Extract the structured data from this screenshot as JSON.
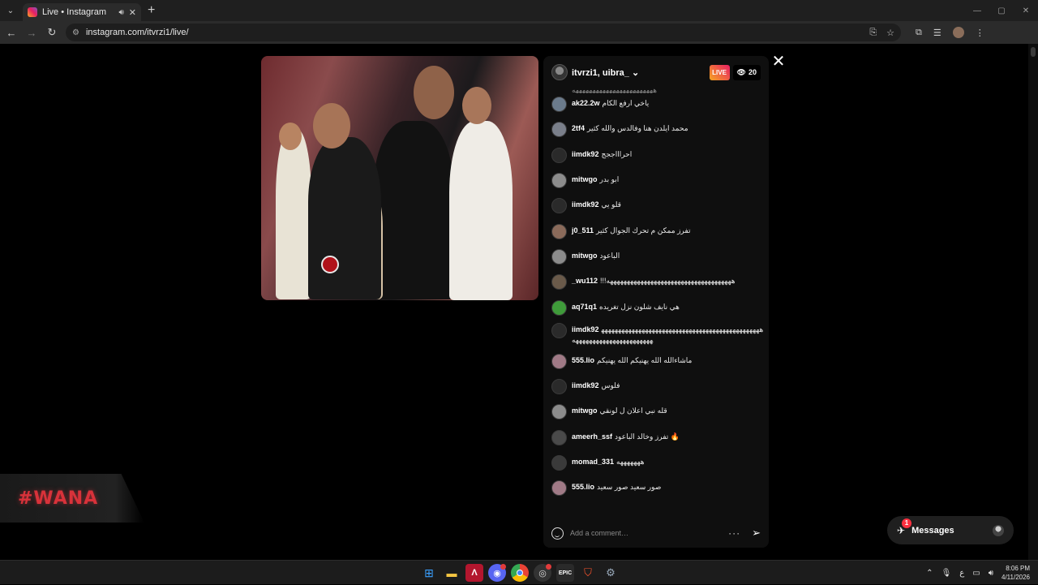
{
  "browser": {
    "tab_title": "Live • Instagram",
    "url": "instagram.com/itvrzi1/live/",
    "tab_list_icon": "chevron-down",
    "new_tab_icon": "+"
  },
  "live": {
    "host_names": "itvrzi1, uibra_",
    "live_label": "LIVE",
    "viewer_count": "20",
    "overlay_logo_text": "#WANA",
    "comment_placeholder": "Add a comment…",
    "truncated_line": "ههههههههههههههههههههههههه",
    "comments": [
      {
        "user": "ak22.2w",
        "text": "ياخي ارفع الكام",
        "avatar_color": "#6b7b8c"
      },
      {
        "user": "2tf4",
        "text": "محمد ايلدن هنا وفالدس والله كثير",
        "avatar_color": "#7a7f8a"
      },
      {
        "user": "iimdk92",
        "text": "احراااججج",
        "avatar_color": "#2a2a2a"
      },
      {
        "user": "mitwgo",
        "text": "ابو بدر",
        "avatar_color": "#8c8c8c"
      },
      {
        "user": "iimdk92",
        "text": "قلو يي",
        "avatar_color": "#2a2a2a"
      },
      {
        "user": "j0_511",
        "text": "تفرز ممكن م تحرك الجوال كثير",
        "avatar_color": "#8a6a5a"
      },
      {
        "user": "mitwgo",
        "text": "الباعود",
        "avatar_color": "#8c8c8c"
      },
      {
        "user": "_wu112",
        "text": "!!!هههههههههههههههههههههههههههههههههههههه",
        "avatar_color": "#6a5a4a"
      },
      {
        "user": "aq71q1",
        "text": "هي نايف شلون نزل تغريده",
        "avatar_color": "#3f9b3a"
      },
      {
        "user": "iimdk92",
        "text": "هههههههههههههههههههههههههههههههههههههههههههههههههههههههههههههههههههههههه",
        "avatar_color": "#2a2a2a"
      },
      {
        "user": "555.lio",
        "text": "ماشاءالله الله يهنيكم الله يهنيكم",
        "avatar_color": "#a07a86"
      },
      {
        "user": "iimdk92",
        "text": "فلوس",
        "avatar_color": "#2a2a2a"
      },
      {
        "user": "mitwgo",
        "text": "قله نبي اعلان ل لونقي",
        "avatar_color": "#8c8c8c"
      },
      {
        "user": "ameerh_ssf",
        "text": "تفرز وخالد الباعود 🔥",
        "avatar_color": "#4a4a4a"
      },
      {
        "user": "momad_331",
        "text": "هههههههه",
        "avatar_color": "#3a3a3a"
      },
      {
        "user": "555.lio",
        "text": "صور سعيد صور سعيد",
        "avatar_color": "#a07a86"
      }
    ]
  },
  "messages_pill": {
    "label": "Messages",
    "badge": "1"
  },
  "taskbar": {
    "apps": [
      "windows-start",
      "file-explorer",
      "affinity",
      "discord",
      "chrome",
      "obs",
      "epic-games",
      "brave",
      "settings"
    ],
    "discord_badge": "9+",
    "lang": "ع",
    "time": "8:06 PM",
    "date": "4/11/2026"
  }
}
